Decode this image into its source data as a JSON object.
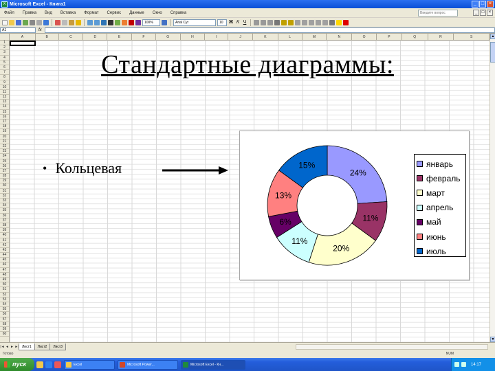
{
  "window": {
    "title": "Microsoft Excel - Книга1",
    "app_icon": "excel-icon"
  },
  "menu": {
    "items": [
      "Файл",
      "Правка",
      "Вид",
      "Вставка",
      "Формат",
      "Сервис",
      "Данные",
      "Окно",
      "Справка"
    ],
    "help_placeholder": "Введите вопрос"
  },
  "toolbar": {
    "zoom": "100%",
    "font": "Arial Cyr",
    "size": "10",
    "bold": "Ж",
    "italic": "К",
    "underline": "Ч"
  },
  "formula": {
    "namebox": "A1",
    "fx": "fx"
  },
  "sheet": {
    "columns": [
      "A",
      "B",
      "C",
      "D",
      "E",
      "F",
      "G",
      "H",
      "I",
      "J",
      "K",
      "L",
      "M",
      "N",
      "O",
      "P",
      "Q",
      "R",
      "S"
    ],
    "rows": [
      "1",
      "2",
      "3",
      "4",
      "5",
      "6",
      "7",
      "8",
      "9",
      "10",
      "11",
      "12",
      "13",
      "14",
      "15",
      "16",
      "17",
      "18",
      "19",
      "20",
      "21",
      "22",
      "23",
      "24",
      "25",
      "26",
      "27",
      "28",
      "29",
      "30",
      "31",
      "32",
      "33",
      "34",
      "35",
      "36",
      "37",
      "38",
      "39",
      "40",
      "41",
      "42",
      "43",
      "44",
      "45",
      "46",
      "47",
      "48",
      "49",
      "50",
      "51",
      "52",
      "53",
      "54",
      "55",
      "56",
      "57",
      "58",
      "59",
      "60"
    ],
    "tabs": [
      "Лист1",
      "Лист2",
      "Лист3"
    ]
  },
  "status": {
    "left": "Готово",
    "right": "NUM"
  },
  "taskbar": {
    "start_label": "пуск",
    "tasks": [
      "Excel",
      "Microsoft Power...",
      "Microsoft Excel - Кн..."
    ],
    "clock": "14:17"
  },
  "slide": {
    "title": "Стандартные диаграммы:",
    "bullet": "Кольцевая"
  },
  "chart_data": {
    "type": "pie",
    "subtype": "doughnut",
    "categories": [
      "январь",
      "февраль",
      "март",
      "апрель",
      "май",
      "июнь",
      "июль"
    ],
    "values": [
      24,
      11,
      20,
      11,
      6,
      13,
      15
    ],
    "labels": [
      "24%",
      "11%",
      "20%",
      "11%",
      "6%",
      "13%",
      "15%"
    ],
    "colors": [
      "#9999ff",
      "#993366",
      "#ffffcc",
      "#ccffff",
      "#660066",
      "#ff8080",
      "#0066cc"
    ],
    "label_colors": [
      "#000000",
      "#000000",
      "#000000",
      "#000000",
      "#000000",
      "#000000",
      "#000000"
    ],
    "legend_position": "right",
    "start_angle_deg": 0,
    "direction": "clockwise"
  }
}
